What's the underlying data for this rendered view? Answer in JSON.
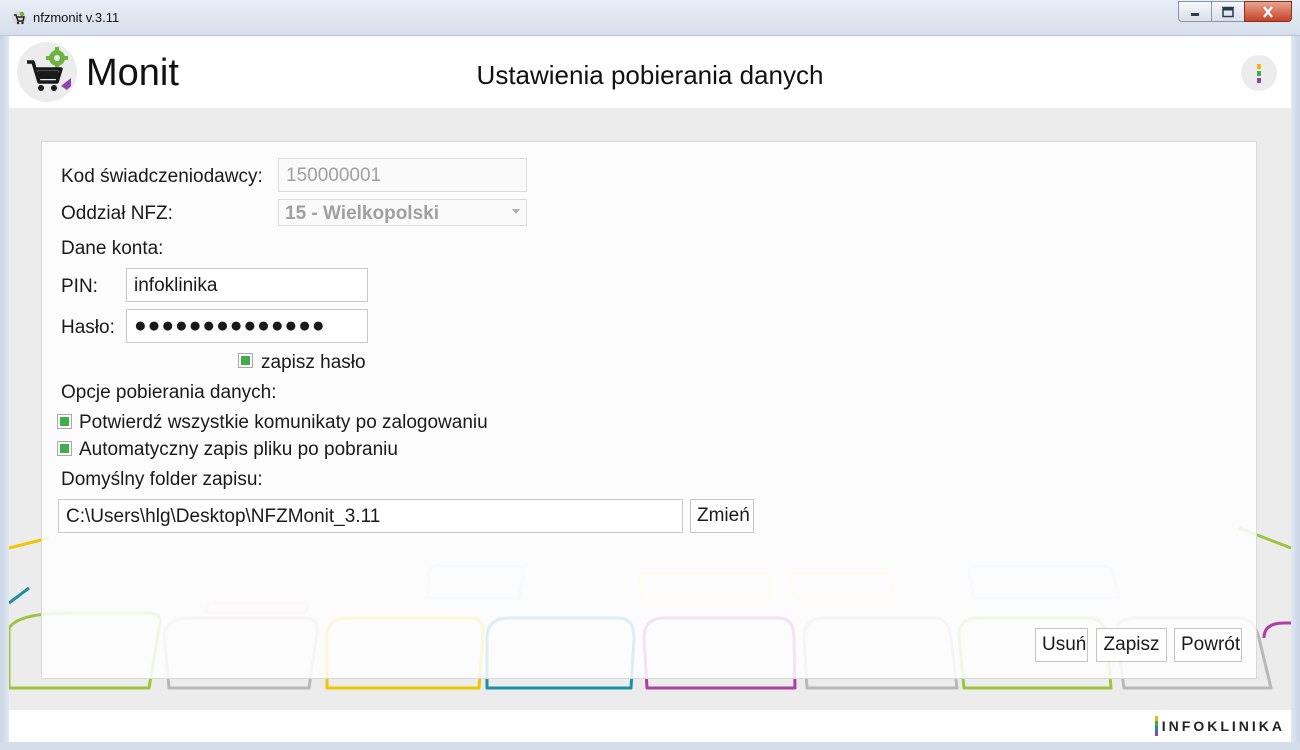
{
  "window": {
    "title": "nfzmonit v.3.11",
    "controls": [
      "minimize",
      "maximize",
      "close"
    ]
  },
  "header": {
    "logo_text": "Monit",
    "page_title": "Ustawienia pobierania danych",
    "menu_icon": "kebab-menu-icon"
  },
  "form": {
    "provider_code_label": "Kod świadczeniodawcy:",
    "provider_code_value": "150000001",
    "nfz_branch_label": "Oddział NFZ:",
    "nfz_branch_value": "15 - Wielkopolski",
    "account_section_label": "Dane konta:",
    "pin_label": "PIN:",
    "pin_value": "infoklinika",
    "password_label": "Hasło:",
    "password_value": "●●●●●●●●●●●●●●",
    "save_password_label": "zapisz hasło",
    "save_password_checked": true,
    "options_section_label": "Opcje pobierania danych:",
    "confirm_messages_label": "Potwierdź wszystkie komunikaty po zalogowaniu",
    "confirm_messages_checked": true,
    "auto_save_label": "Automatyczny zapis pliku po pobraniu",
    "auto_save_checked": true,
    "default_folder_label": "Domyślny folder zapisu:",
    "default_folder_value": "C:\\Users\\hlg\\Desktop\\NFZMonit_3.11",
    "change_button": "Zmień"
  },
  "actions": {
    "delete": "Usuń",
    "save": "Zapisz",
    "back": "Powrót"
  },
  "footer": {
    "brand": "INFOKLINIKA"
  },
  "colors": {
    "check_green": "#3fae49",
    "cart_purple": "#8e44ad",
    "gear_green": "#6cb33f"
  }
}
